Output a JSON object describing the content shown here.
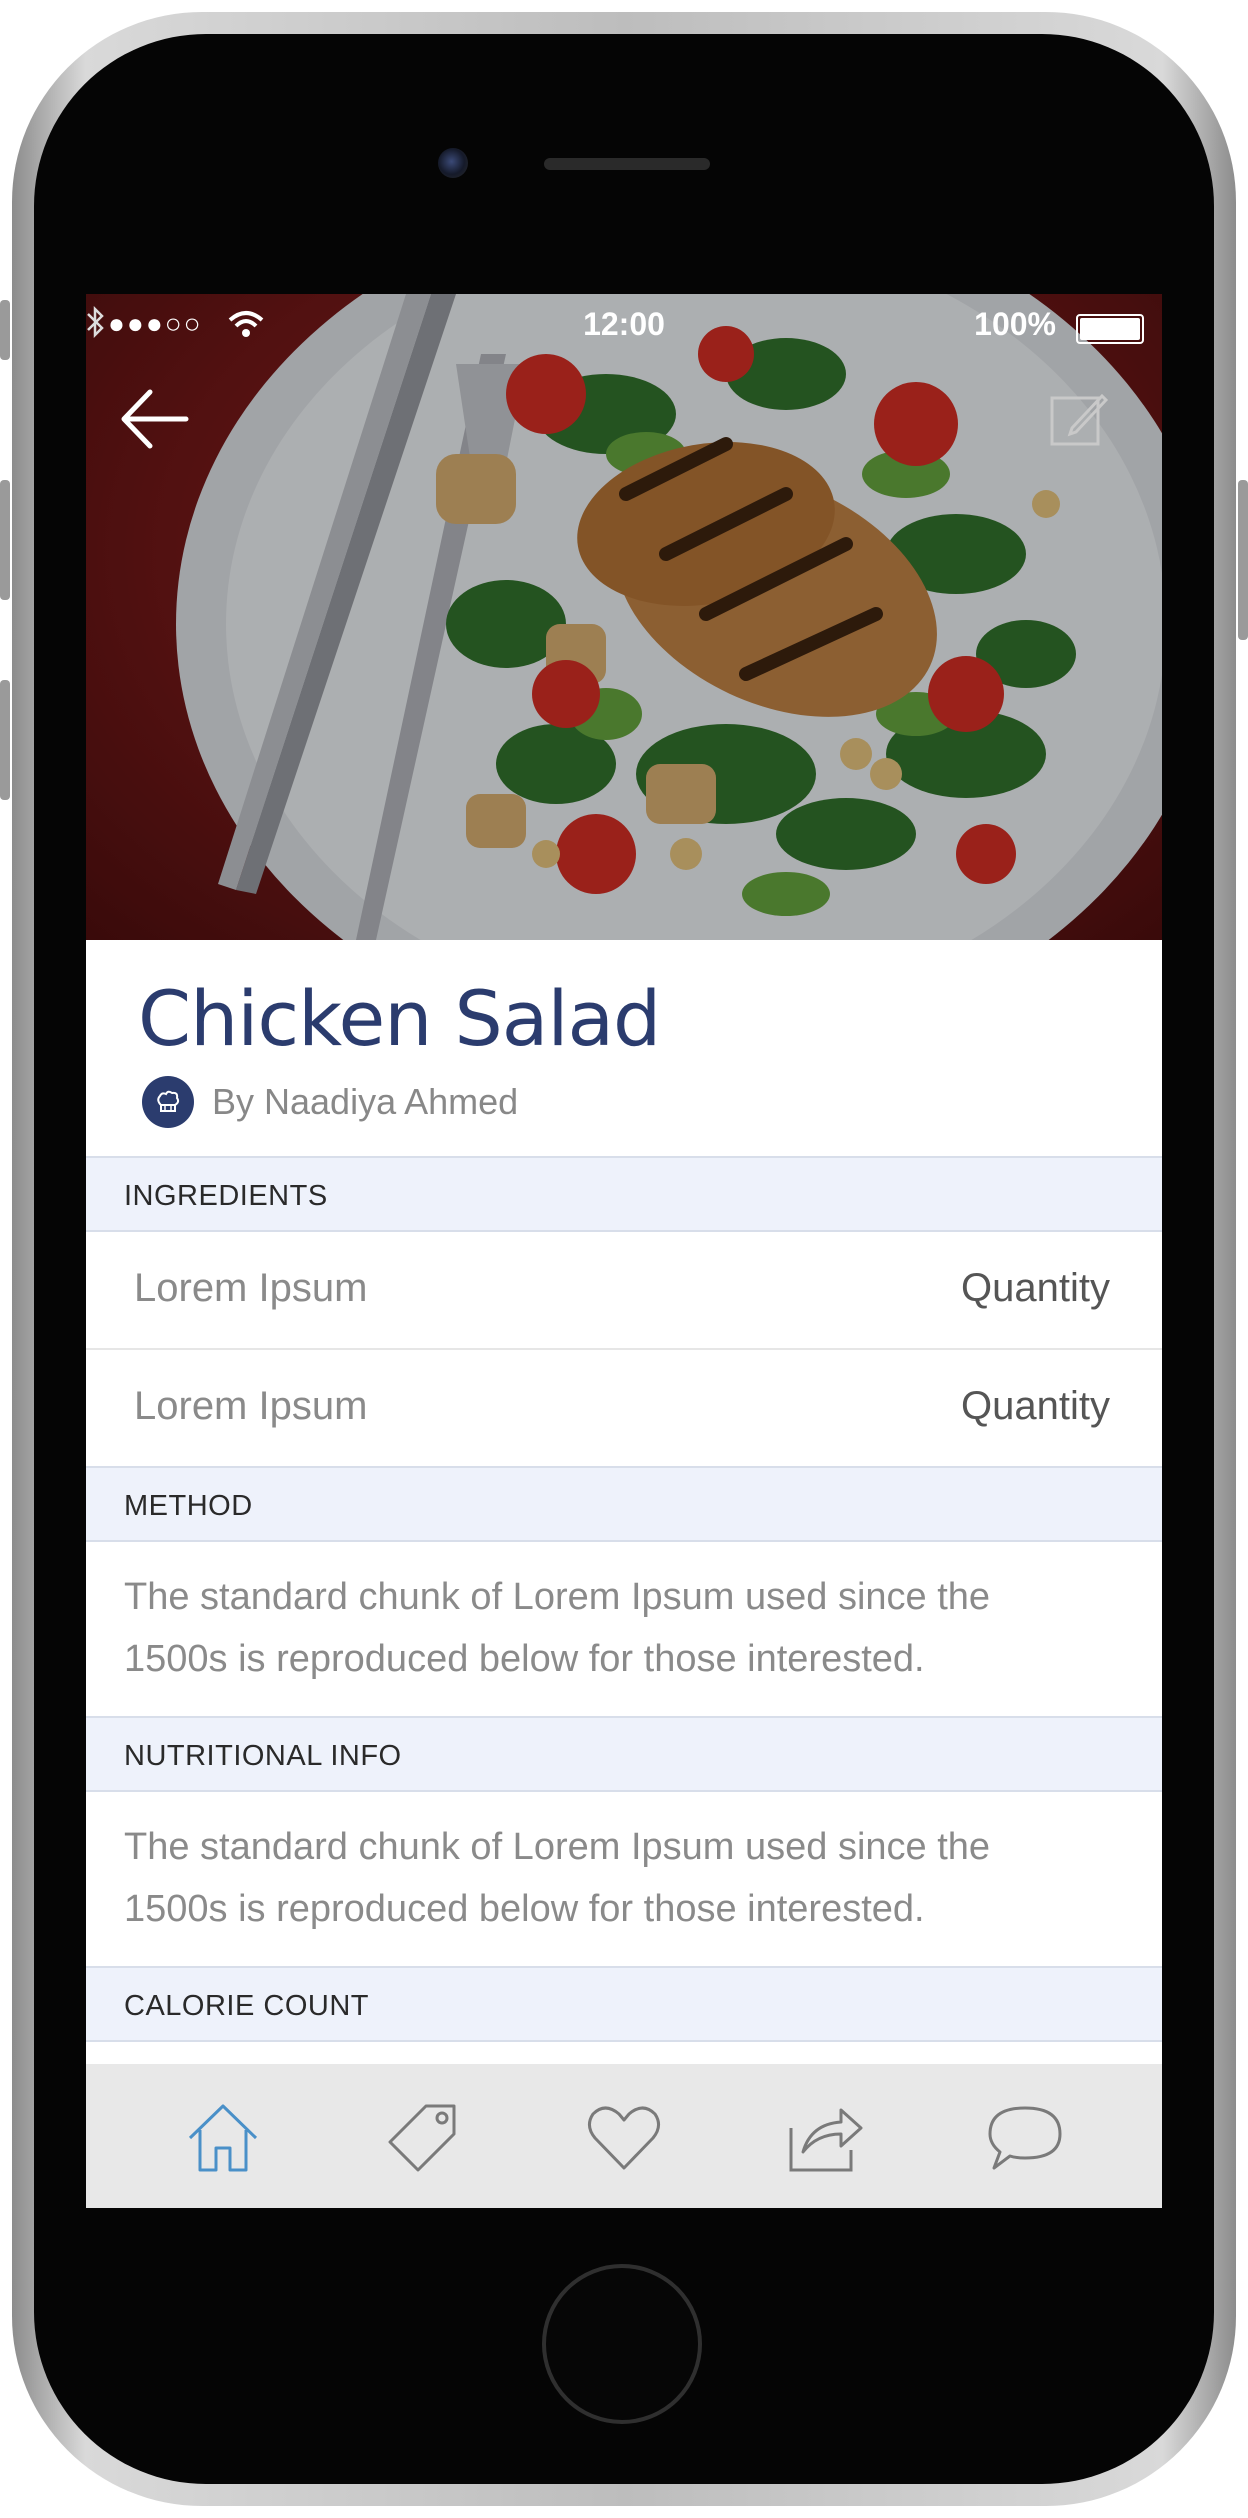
{
  "status_bar": {
    "signal": "●●●○○",
    "time": "12:00",
    "battery": "100%"
  },
  "recipe": {
    "title": "Chicken Salad",
    "author": "By Naadiya Ahmed"
  },
  "sections": {
    "ingredients": {
      "heading": "INGREDIENTS",
      "items": [
        {
          "name": "Lorem Ipsum",
          "quantity": "Quantity"
        },
        {
          "name": "Lorem Ipsum",
          "quantity": "Quantity"
        }
      ]
    },
    "method": {
      "heading": "METHOD",
      "lines": [
        "The standard chunk of Lorem Ipsum used since the",
        "1500s is reproduced below for those interested."
      ]
    },
    "nutrition": {
      "heading": "NUTRITIONAL INFO",
      "lines": [
        "The standard chunk of Lorem Ipsum used since the",
        "1500s is reproduced below for those interested."
      ]
    },
    "calories": {
      "heading": "CALORIE COUNT"
    }
  },
  "tab_bar": {
    "active": "home",
    "tabs": [
      "home-icon",
      "tag-icon",
      "heart-icon",
      "share-icon",
      "chat-icon"
    ],
    "active_color": "#4a90c8",
    "inactive_color": "#7a7a7a"
  },
  "colors": {
    "title": "#2b3c6e",
    "section_bg": "#eef2fb"
  }
}
